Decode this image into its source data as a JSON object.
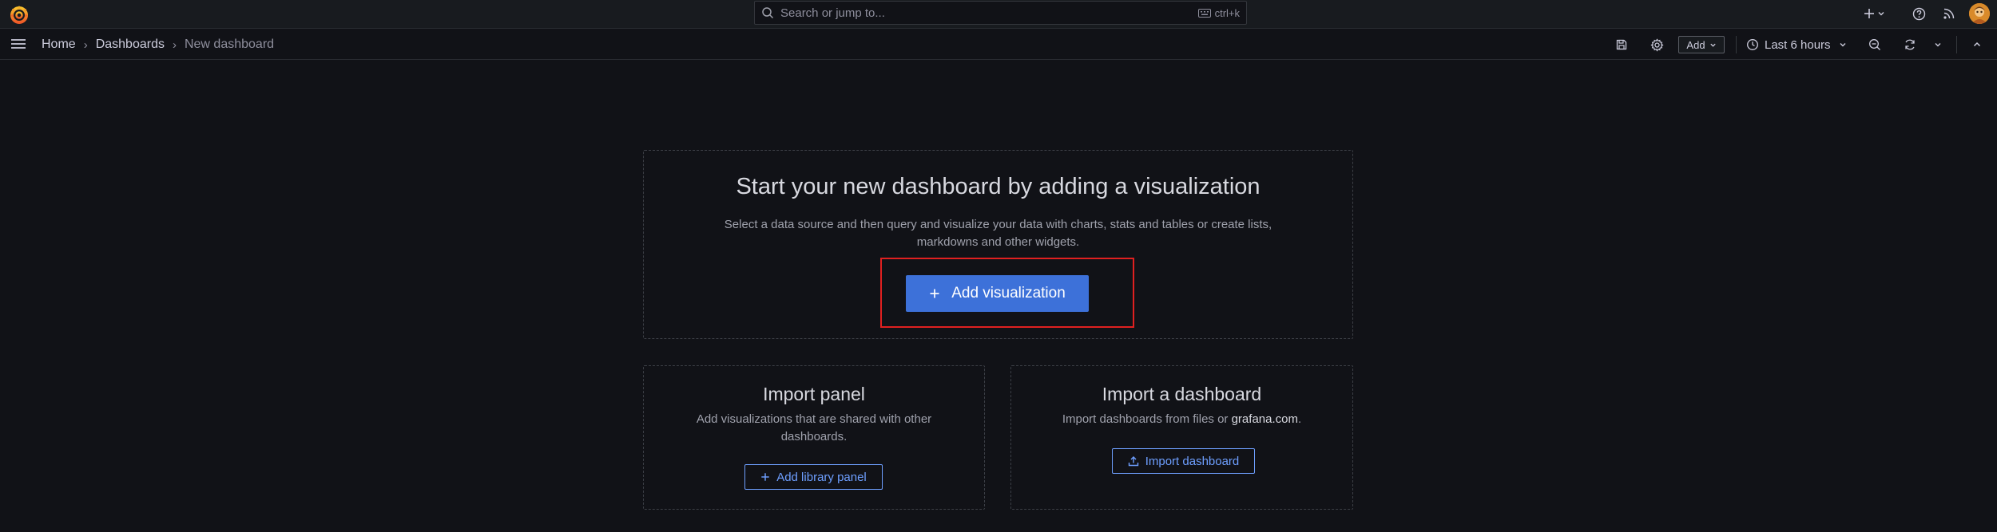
{
  "app": {
    "name": "Grafana"
  },
  "search": {
    "placeholder": "Search or jump to...",
    "shortcut": "ctrl+k"
  },
  "breadcrumb": {
    "home": "Home",
    "dashboards": "Dashboards",
    "current": "New dashboard",
    "separator": "›"
  },
  "toolbar": {
    "add_label": "Add",
    "time_range": "Last 6 hours"
  },
  "main": {
    "title": "Start your new dashboard by adding a visualization",
    "description": "Select a data source and then query and visualize your data with charts, stats and tables or create lists, markdowns and other widgets.",
    "add_visualization": "Add visualization"
  },
  "import_panel": {
    "title": "Import panel",
    "description": "Add visualizations that are shared with other dashboards.",
    "button": "Add library panel"
  },
  "import_dashboard": {
    "title": "Import a dashboard",
    "description_prefix": "Import dashboards from files or ",
    "description_link": "grafana.com",
    "description_suffix": ".",
    "button": "Import dashboard"
  },
  "colors": {
    "background": "#111217",
    "topbar": "#181b1f",
    "primary": "#3d71d9",
    "link": "#6e9fff",
    "highlight": "#e02020",
    "logo": "#f46800"
  }
}
